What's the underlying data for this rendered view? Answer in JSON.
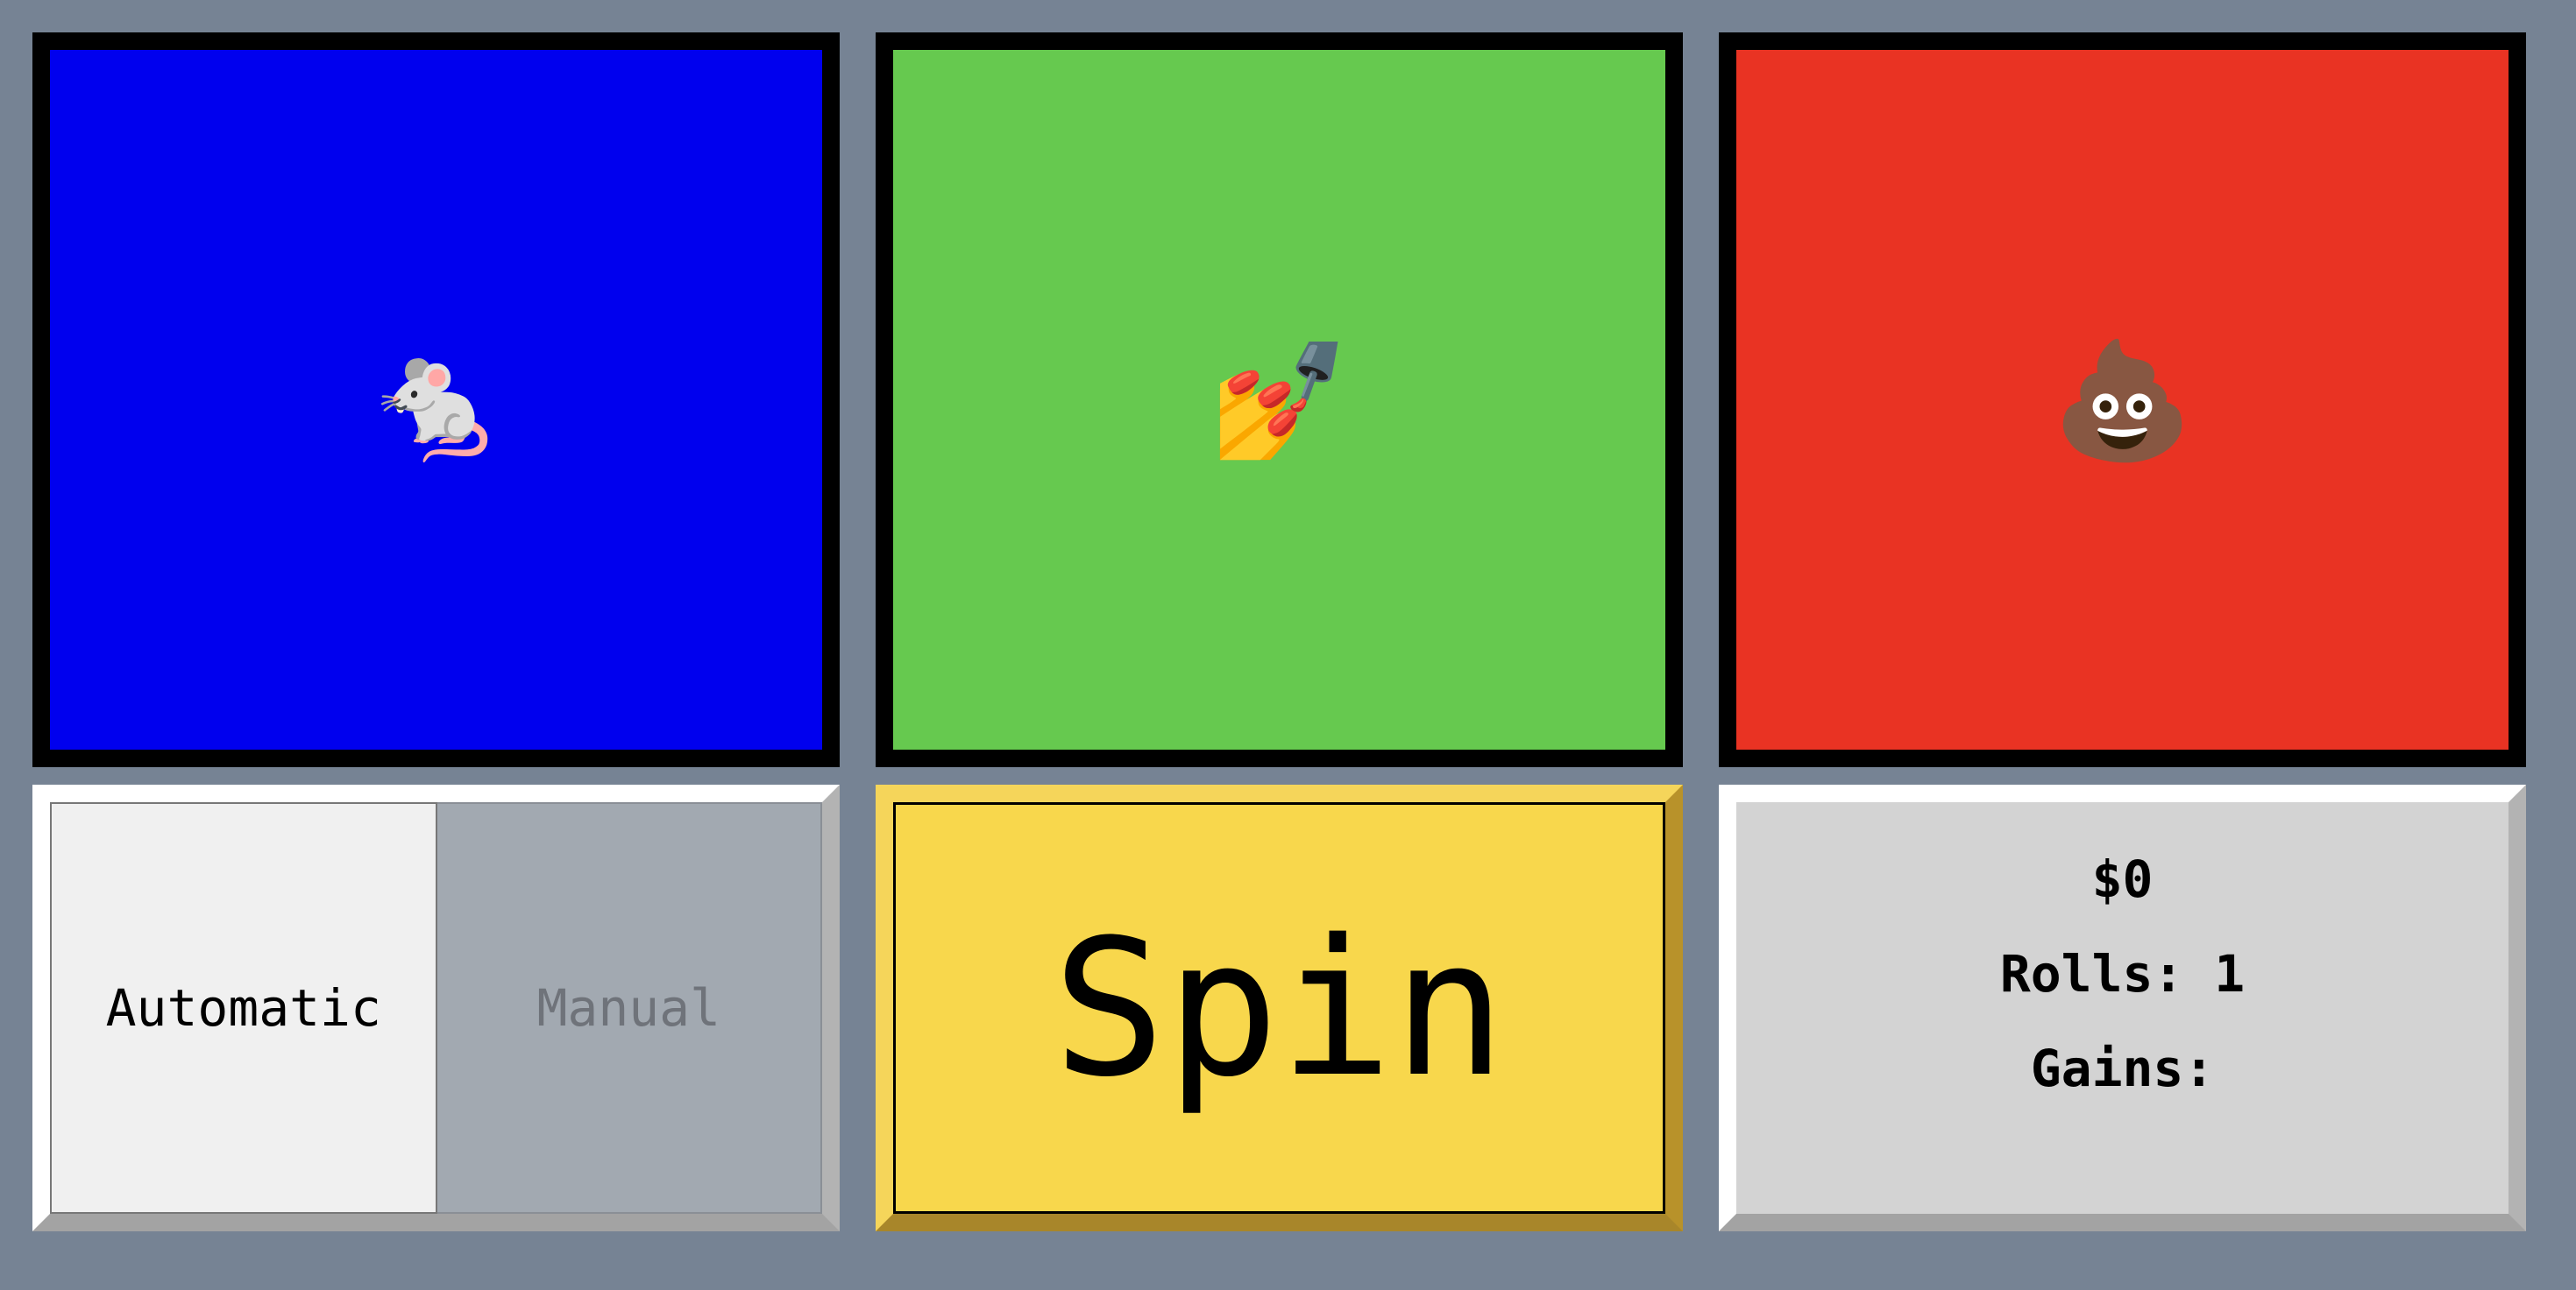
{
  "reels": [
    {
      "symbol": "🐁",
      "icon": "mouse-icon",
      "color": "#0000ee"
    },
    {
      "symbol": "💅",
      "icon": "nail-polish-icon",
      "color": "#66c94f"
    },
    {
      "symbol": "💩",
      "icon": "pile-of-poo-icon",
      "color": "#e93323"
    }
  ],
  "modes": {
    "automatic_label": "Automatic",
    "manual_label": "Manual",
    "selected": "Automatic"
  },
  "spin": {
    "label": "Spin",
    "color": "#f8d74c"
  },
  "stats": {
    "money": "$0",
    "rolls": "Rolls: 1",
    "gains": "Gains:"
  },
  "colors": {
    "background": "#768394",
    "frame": "#000000"
  }
}
